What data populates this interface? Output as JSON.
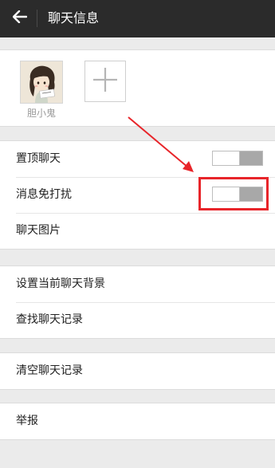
{
  "topbar": {
    "back_icon": "back-arrow-icon",
    "title": "聊天信息"
  },
  "members": {
    "list": [
      {
        "name": "胆小鬼",
        "avatar_icon": "cartoon-girl-avatar"
      }
    ],
    "add_icon": "plus-icon"
  },
  "settings": {
    "pin_chat": {
      "label": "置顶聊天",
      "enabled": false
    },
    "mute": {
      "label": "消息免打扰",
      "enabled": false
    },
    "chat_images": {
      "label": "聊天图片"
    },
    "set_background": {
      "label": "设置当前聊天背景"
    },
    "search_history": {
      "label": "查找聊天记录"
    },
    "clear_history": {
      "label": "清空聊天记录"
    },
    "report": {
      "label": "举报"
    }
  },
  "annotation": {
    "color": "#e8252a"
  }
}
